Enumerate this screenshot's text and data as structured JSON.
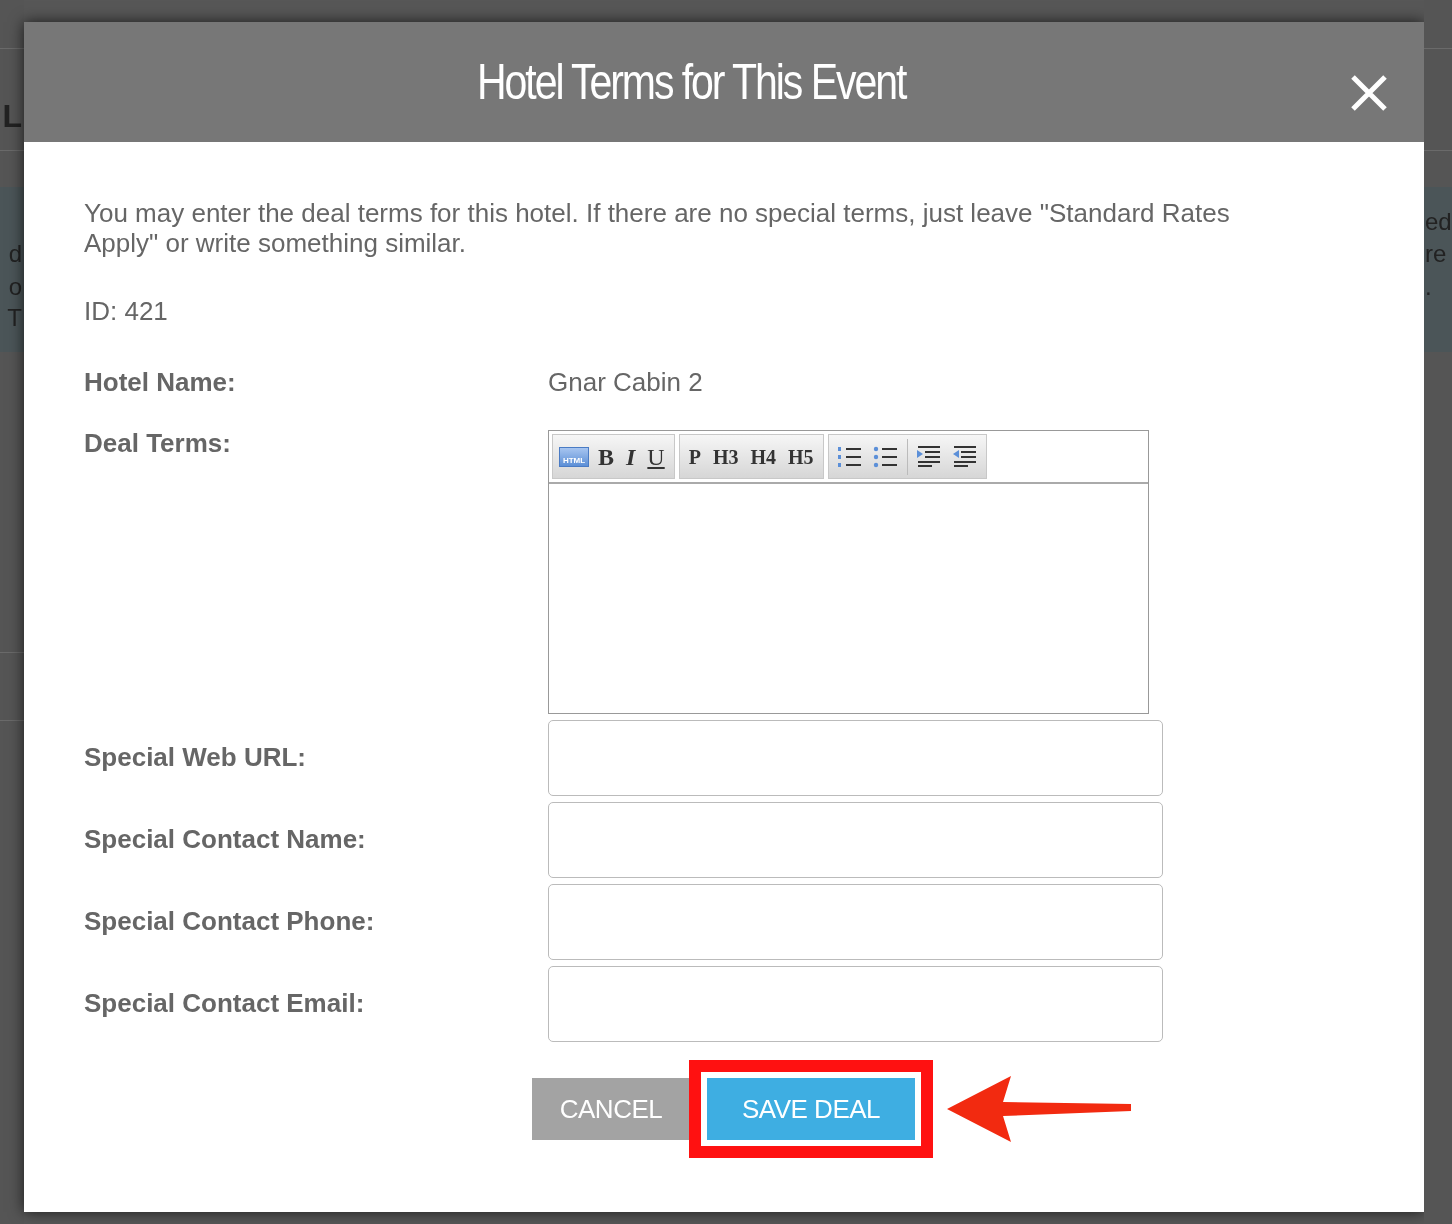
{
  "background": {
    "left_fragments": [
      "L",
      "d",
      "o",
      "T"
    ],
    "right_fragments": [
      "ed",
      "re",
      "."
    ]
  },
  "dialog": {
    "title": "Hotel Terms for This Event",
    "intro": "You may enter the deal terms for this hotel. If there are no special terms, just leave \"Standard Rates Apply\" or write something similar.",
    "id_text": "ID: 421",
    "fields": [
      {
        "kind": "text",
        "label": "Hotel Name:",
        "value": "Gnar Cabin 2"
      },
      {
        "kind": "editor",
        "label": "Deal Terms:"
      },
      {
        "kind": "input",
        "label": "Special Web URL:"
      },
      {
        "kind": "input",
        "label": "Special Contact Name:"
      },
      {
        "kind": "input",
        "label": "Special Contact Phone:"
      },
      {
        "kind": "input",
        "label": "Special Contact Email:"
      }
    ],
    "toolbar": [
      [
        {
          "kind": "html",
          "label": "HTML"
        },
        {
          "kind": "bold",
          "label": "B"
        },
        {
          "kind": "italic",
          "label": "I"
        },
        {
          "kind": "underline",
          "label": "U"
        }
      ],
      [
        {
          "kind": "plain",
          "label": "P"
        },
        {
          "kind": "plain",
          "label": "H3"
        },
        {
          "kind": "plain",
          "label": "H4"
        },
        {
          "kind": "plain",
          "label": "H5"
        }
      ],
      [
        {
          "kind": "ordered-list"
        },
        {
          "kind": "bullet-list"
        },
        {
          "kind": "separator"
        },
        {
          "kind": "indent"
        },
        {
          "kind": "outdent"
        }
      ]
    ],
    "buttons": [
      {
        "label": "CANCEL",
        "kind": "secondary",
        "highlighted": false
      },
      {
        "label": "SAVE DEAL",
        "kind": "primary",
        "highlighted": true
      }
    ],
    "callout_arrow": true
  }
}
